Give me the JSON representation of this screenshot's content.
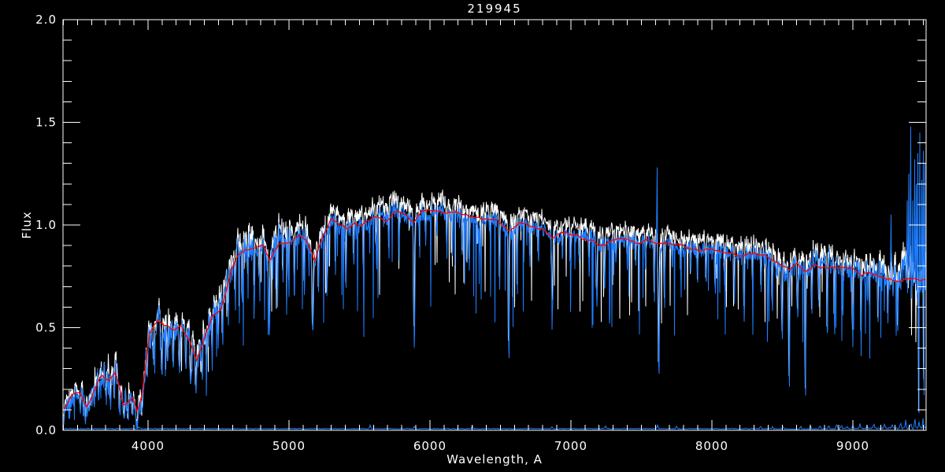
{
  "chart_data": {
    "type": "line",
    "title": "219945",
    "xlabel": "Wavelength, A",
    "ylabel": "Flux",
    "xlim": [
      3397,
      9520
    ],
    "ylim": [
      0.0,
      2.0
    ],
    "x_major_ticks": [
      4000,
      5000,
      6000,
      7000,
      8000,
      9000
    ],
    "x_tick_labels": [
      "4000",
      "5000",
      "6000",
      "7000",
      "8000",
      "9000"
    ],
    "x_minor_step": 100,
    "y_major_ticks": [
      0.0,
      0.5,
      1.0,
      1.5,
      2.0
    ],
    "y_tick_labels": [
      "0.0",
      "0.5",
      "1.0",
      "1.5",
      "2.0"
    ],
    "y_minor_step": 0.1,
    "grid": false,
    "legend": null,
    "colors": {
      "background": "#000000",
      "axis": "#ffffff",
      "raw_spectrum": "#ffffff",
      "spectrum": "#1e7eff",
      "continuum_fit": "#ff0000",
      "sky_baseline": "#1e7eff"
    },
    "series": [
      {
        "name": "raw-spectrum",
        "color": "#ffffff",
        "description": "noisy spectrum drawn beneath, slightly higher flux"
      },
      {
        "name": "observed-spectrum",
        "color": "#1e7eff",
        "description": "main noisy observed spectrum"
      },
      {
        "name": "continuum-fit",
        "color": "#ff0000",
        "description": "smooth red continuum fit"
      },
      {
        "name": "sky-baseline",
        "color": "#1e7eff",
        "description": "near-zero baseline with bumps at red end"
      }
    ],
    "continuum_points": [
      [
        3397,
        0.1
      ],
      [
        3430,
        0.13
      ],
      [
        3455,
        0.165
      ],
      [
        3480,
        0.175
      ],
      [
        3510,
        0.19
      ],
      [
        3540,
        0.15
      ],
      [
        3565,
        0.12
      ],
      [
        3595,
        0.16
      ],
      [
        3620,
        0.2
      ],
      [
        3648,
        0.24
      ],
      [
        3675,
        0.275
      ],
      [
        3700,
        0.26
      ],
      [
        3725,
        0.25
      ],
      [
        3748,
        0.27
      ],
      [
        3770,
        0.28
      ],
      [
        3795,
        0.22
      ],
      [
        3825,
        0.12
      ],
      [
        3848,
        0.13
      ],
      [
        3865,
        0.15
      ],
      [
        3893,
        0.17
      ],
      [
        3920,
        0.09
      ],
      [
        3940,
        0.12
      ],
      [
        3955,
        0.17
      ],
      [
        3980,
        0.3
      ],
      [
        4010,
        0.46
      ],
      [
        4040,
        0.5
      ],
      [
        4070,
        0.53
      ],
      [
        4100,
        0.51
      ],
      [
        4125,
        0.5
      ],
      [
        4155,
        0.49
      ],
      [
        4180,
        0.48
      ],
      [
        4210,
        0.5
      ],
      [
        4235,
        0.51
      ],
      [
        4260,
        0.48
      ],
      [
        4290,
        0.45
      ],
      [
        4320,
        0.4
      ],
      [
        4345,
        0.345
      ],
      [
        4375,
        0.4
      ],
      [
        4400,
        0.45
      ],
      [
        4430,
        0.5
      ],
      [
        4460,
        0.56
      ],
      [
        4490,
        0.58
      ],
      [
        4515,
        0.6
      ],
      [
        4550,
        0.68
      ],
      [
        4590,
        0.8
      ],
      [
        4640,
        0.87
      ],
      [
        4700,
        0.88
      ],
      [
        4760,
        0.89
      ],
      [
        4820,
        0.9
      ],
      [
        4861,
        0.83
      ],
      [
        4900,
        0.88
      ],
      [
        4930,
        0.91
      ],
      [
        4980,
        0.92
      ],
      [
        5030,
        0.93
      ],
      [
        5070,
        0.94
      ],
      [
        5130,
        0.91
      ],
      [
        5184,
        0.81
      ],
      [
        5240,
        0.93
      ],
      [
        5300,
        1.02
      ],
      [
        5350,
        0.99
      ],
      [
        5410,
        0.97
      ],
      [
        5470,
        1.0
      ],
      [
        5520,
        1.0
      ],
      [
        5580,
        1.02
      ],
      [
        5630,
        1.04
      ],
      [
        5690,
        1.02
      ],
      [
        5740,
        1.06
      ],
      [
        5800,
        1.06
      ],
      [
        5890,
        1.0
      ],
      [
        5950,
        1.06
      ],
      [
        6010,
        1.06
      ],
      [
        6070,
        1.06
      ],
      [
        6150,
        1.05
      ],
      [
        6230,
        1.04
      ],
      [
        6310,
        1.03
      ],
      [
        6400,
        1.02
      ],
      [
        6480,
        1.01
      ],
      [
        6560,
        0.96
      ],
      [
        6640,
        1.0
      ],
      [
        6720,
        0.99
      ],
      [
        6800,
        0.97
      ],
      [
        6870,
        0.94
      ],
      [
        6960,
        0.96
      ],
      [
        7050,
        0.95
      ],
      [
        7140,
        0.93
      ],
      [
        7200,
        0.9
      ],
      [
        7300,
        0.92
      ],
      [
        7400,
        0.92
      ],
      [
        7500,
        0.91
      ],
      [
        7570,
        0.92
      ],
      [
        7625,
        0.895
      ],
      [
        7700,
        0.9
      ],
      [
        7800,
        0.89
      ],
      [
        7900,
        0.88
      ],
      [
        8000,
        0.87
      ],
      [
        8100,
        0.86
      ],
      [
        8200,
        0.85
      ],
      [
        8300,
        0.855
      ],
      [
        8400,
        0.84
      ],
      [
        8500,
        0.8
      ],
      [
        8555,
        0.77
      ],
      [
        8600,
        0.8
      ],
      [
        8665,
        0.77
      ],
      [
        8720,
        0.81
      ],
      [
        8800,
        0.8
      ],
      [
        8900,
        0.8
      ],
      [
        9000,
        0.78
      ],
      [
        9060,
        0.75
      ],
      [
        9120,
        0.78
      ],
      [
        9200,
        0.76
      ],
      [
        9300,
        0.74
      ],
      [
        9400,
        0.74
      ],
      [
        9520,
        0.73
      ]
    ],
    "absorption_lines": [
      [
        3520,
        0.45,
        7
      ],
      [
        3560,
        0.55,
        7
      ],
      [
        3585,
        0.5,
        6
      ],
      [
        3620,
        0.45,
        6
      ],
      [
        3650,
        0.4,
        6
      ],
      [
        3705,
        0.5,
        7
      ],
      [
        3735,
        0.55,
        7
      ],
      [
        3763,
        0.5,
        5
      ],
      [
        3798,
        0.55,
        6
      ],
      [
        3830,
        0.6,
        8
      ],
      [
        3860,
        0.5,
        6
      ],
      [
        3890,
        0.55,
        7
      ],
      [
        3925,
        0.6,
        7
      ],
      [
        3960,
        0.55,
        7
      ],
      [
        3995,
        0.35,
        6
      ],
      [
        4040,
        0.4,
        6
      ],
      [
        4100,
        0.45,
        7
      ],
      [
        4140,
        0.35,
        6
      ],
      [
        4180,
        0.35,
        6
      ],
      [
        4225,
        0.45,
        7
      ],
      [
        4270,
        0.4,
        6
      ],
      [
        4305,
        0.5,
        8
      ],
      [
        4340,
        0.5,
        7
      ],
      [
        4385,
        0.4,
        6
      ],
      [
        4415,
        0.35,
        5
      ],
      [
        4455,
        0.35,
        6
      ],
      [
        4500,
        0.3,
        5
      ],
      [
        4530,
        0.35,
        5
      ],
      [
        4570,
        0.3,
        5
      ],
      [
        4620,
        0.3,
        5
      ],
      [
        4670,
        0.35,
        5
      ],
      [
        4710,
        0.25,
        4
      ],
      [
        4755,
        0.3,
        5
      ],
      [
        4790,
        0.25,
        4
      ],
      [
        4861,
        0.4,
        7
      ],
      [
        4920,
        0.3,
        5
      ],
      [
        4958,
        0.25,
        4
      ],
      [
        5000,
        0.3,
        5
      ],
      [
        5040,
        0.25,
        4
      ],
      [
        5110,
        0.3,
        5
      ],
      [
        5170,
        0.45,
        9
      ],
      [
        5210,
        0.25,
        4
      ],
      [
        5270,
        0.35,
        6
      ],
      [
        5330,
        0.25,
        4
      ],
      [
        5405,
        0.3,
        5
      ],
      [
        5460,
        0.2,
        4
      ],
      [
        5530,
        0.25,
        4
      ],
      [
        5620,
        0.2,
        4
      ],
      [
        5710,
        0.2,
        4
      ],
      [
        5782,
        0.2,
        4
      ],
      [
        5890,
        0.55,
        8
      ],
      [
        5970,
        0.15,
        4
      ],
      [
        6050,
        0.15,
        4
      ],
      [
        6120,
        0.2,
        4
      ],
      [
        6160,
        0.2,
        4
      ],
      [
        6230,
        0.2,
        4
      ],
      [
        6280,
        0.25,
        5
      ],
      [
        6360,
        0.2,
        4
      ],
      [
        6430,
        0.15,
        4
      ],
      [
        6495,
        0.3,
        5
      ],
      [
        6560,
        0.6,
        6
      ],
      [
        6620,
        0.35,
        4
      ],
      [
        6710,
        0.2,
        4
      ],
      [
        6770,
        0.2,
        4
      ],
      [
        6870,
        0.35,
        9
      ],
      [
        6940,
        0.15,
        4
      ],
      [
        7000,
        0.18,
        4
      ],
      [
        7060,
        0.15,
        4
      ],
      [
        7130,
        0.2,
        5
      ],
      [
        7185,
        0.3,
        8
      ],
      [
        7240,
        0.25,
        6
      ],
      [
        7320,
        0.15,
        4
      ],
      [
        7400,
        0.15,
        4
      ],
      [
        7460,
        0.15,
        4
      ],
      [
        7530,
        0.15,
        4
      ],
      [
        7593,
        0.3,
        4
      ],
      [
        7625,
        0.72,
        7
      ],
      [
        7665,
        0.35,
        5
      ],
      [
        7720,
        0.15,
        4
      ],
      [
        7780,
        0.15,
        4
      ],
      [
        7850,
        0.18,
        4
      ],
      [
        7900,
        0.2,
        4
      ],
      [
        7960,
        0.2,
        4
      ],
      [
        8025,
        0.25,
        5
      ],
      [
        8090,
        0.2,
        4
      ],
      [
        8160,
        0.3,
        5
      ],
      [
        8230,
        0.35,
        6
      ],
      [
        8290,
        0.2,
        4
      ],
      [
        8350,
        0.2,
        4
      ],
      [
        8430,
        0.3,
        5
      ],
      [
        8500,
        0.45,
        6
      ],
      [
        8550,
        0.75,
        5
      ],
      [
        8610,
        0.3,
        5
      ],
      [
        8665,
        0.78,
        5
      ],
      [
        8710,
        0.3,
        4
      ],
      [
        8760,
        0.3,
        4
      ],
      [
        8820,
        0.45,
        5
      ],
      [
        8870,
        0.35,
        4
      ],
      [
        8930,
        0.35,
        4
      ],
      [
        9000,
        0.45,
        5
      ],
      [
        9060,
        0.4,
        5
      ],
      [
        9120,
        0.35,
        4
      ],
      [
        9180,
        0.3,
        4
      ],
      [
        9250,
        0.35,
        4
      ],
      [
        9320,
        0.35,
        4
      ],
      [
        9470,
        0.9,
        3
      ],
      [
        9505,
        0.95,
        3
      ]
    ],
    "emission_spikes": [
      [
        7612,
        1.28
      ],
      [
        9270,
        1.05
      ],
      [
        9385,
        1.12
      ],
      [
        9398,
        1.25
      ],
      [
        9412,
        1.48
      ],
      [
        9425,
        1.12
      ],
      [
        9438,
        1.32
      ],
      [
        9450,
        1.2
      ],
      [
        9462,
        1.35
      ],
      [
        9475,
        1.45
      ],
      [
        9488,
        1.22
      ],
      [
        9500,
        1.36
      ],
      [
        9512,
        1.3
      ]
    ],
    "noise_profile": [
      [
        3400,
        0.05
      ],
      [
        3900,
        0.055
      ],
      [
        4300,
        0.05
      ],
      [
        4650,
        0.05
      ],
      [
        5200,
        0.045
      ],
      [
        5600,
        0.04
      ],
      [
        6000,
        0.035
      ],
      [
        6700,
        0.03
      ],
      [
        7300,
        0.03
      ],
      [
        7900,
        0.032
      ],
      [
        8400,
        0.04
      ],
      [
        8900,
        0.045
      ],
      [
        9200,
        0.06
      ],
      [
        9520,
        0.085
      ]
    ],
    "noise_seed": 77,
    "sky_baseline": {
      "level": 0.006,
      "bumps": [
        [
          3934,
          0.012
        ],
        [
          4300,
          0.01
        ],
        [
          5577,
          0.022
        ],
        [
          5890,
          0.015
        ],
        [
          6300,
          0.02
        ],
        [
          6864,
          0.015
        ],
        [
          7245,
          0.015
        ],
        [
          7615,
          0.02
        ],
        [
          7750,
          0.012
        ],
        [
          8345,
          0.018
        ],
        [
          8430,
          0.015
        ],
        [
          8505,
          0.012
        ],
        [
          8630,
          0.015
        ],
        [
          8700,
          0.02
        ],
        [
          8767,
          0.025
        ],
        [
          8830,
          0.02
        ],
        [
          8885,
          0.03
        ],
        [
          8920,
          0.025
        ],
        [
          8960,
          0.02
        ],
        [
          9000,
          0.025
        ],
        [
          9050,
          0.035
        ],
        [
          9100,
          0.02
        ],
        [
          9150,
          0.025
        ],
        [
          9225,
          0.03
        ],
        [
          9280,
          0.02
        ],
        [
          9340,
          0.035
        ],
        [
          9375,
          0.045
        ],
        [
          9410,
          0.035
        ],
        [
          9440,
          0.05
        ],
        [
          9470,
          0.04
        ],
        [
          9500,
          0.055
        ]
      ]
    }
  }
}
